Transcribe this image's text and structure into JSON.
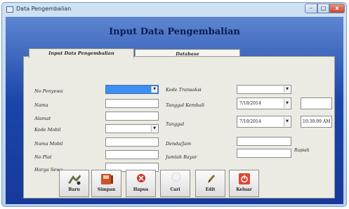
{
  "window": {
    "title": "Data Pengembalian",
    "close_label": "x"
  },
  "header": {
    "title": "Input Data Pengembalian"
  },
  "tabs": [
    {
      "label": "Input Data Pengembalian"
    },
    {
      "label": "Database"
    }
  ],
  "left_fields": [
    {
      "label": "No Penyewa",
      "value": ""
    },
    {
      "label": "Nama",
      "value": ""
    },
    {
      "label": "Alamat",
      "value": ""
    },
    {
      "label": "Kode Mobil",
      "value": ""
    },
    {
      "label": "Nama Mobil",
      "value": ""
    },
    {
      "label": "No Plat",
      "value": ""
    },
    {
      "label": "Harga Sewa",
      "value": ""
    }
  ],
  "right_fields": {
    "kode_transaksi": {
      "label": "Kode Transaksi",
      "value": ""
    },
    "tanggal_kembali": {
      "label": "Tanggal Kembali",
      "value": "7/10/2014",
      "extra": ""
    },
    "tanggal": {
      "label": "Tanggal",
      "value": "7/10/2014",
      "time": "10:30:09 AM"
    },
    "denda_jam": {
      "label": "Denda/Jam",
      "value": ""
    },
    "jumlah_bayar": {
      "label": "Jumlah Bayar",
      "value": "",
      "unit": "Rupiah"
    }
  },
  "buttons": [
    {
      "label": "Baru",
      "icon": "new-icon"
    },
    {
      "label": "Simpan",
      "icon": "save-icon"
    },
    {
      "label": "Hapus",
      "icon": "delete-icon"
    },
    {
      "label": "Cari",
      "icon": "search-icon"
    },
    {
      "label": "Edit",
      "icon": "edit-icon"
    },
    {
      "label": "Keluar",
      "icon": "power-icon"
    }
  ],
  "colors": {
    "client_bg": "#1b45aa",
    "selected_field": "#3f8ff0",
    "panel": "#ecebe3"
  }
}
